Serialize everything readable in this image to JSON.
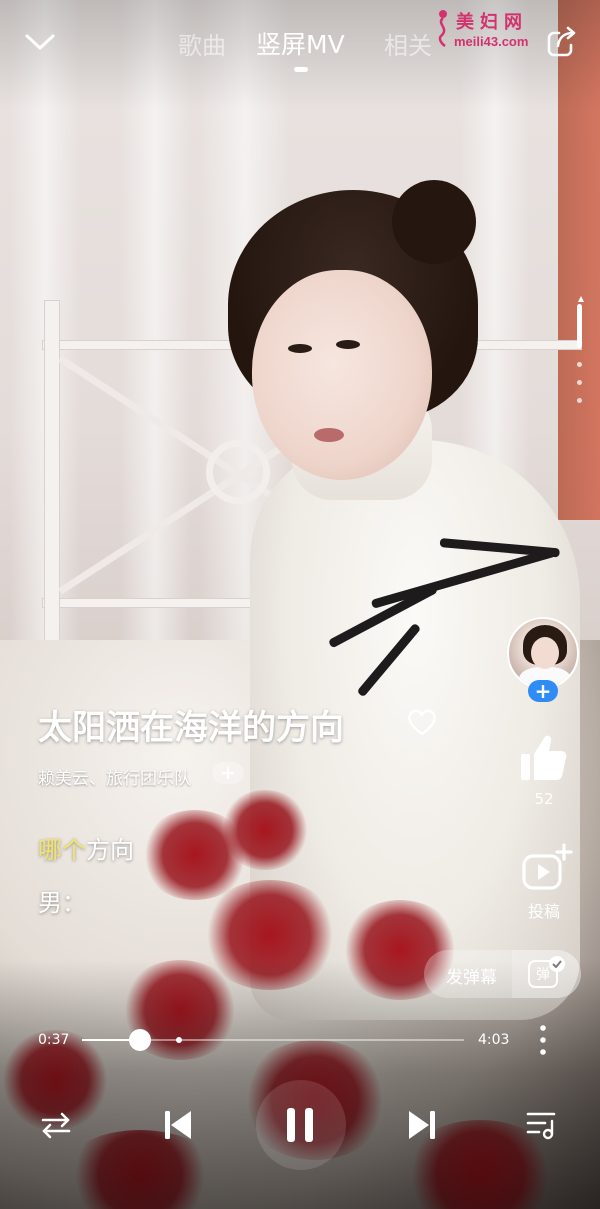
{
  "header": {
    "tabs": [
      {
        "label": "歌曲",
        "active": false
      },
      {
        "label": "竖屏MV",
        "active": true
      },
      {
        "label": "相关",
        "active": false
      }
    ],
    "watermark": {
      "title": "美妇网",
      "url": "meili43.com"
    }
  },
  "song": {
    "title": "太阳洒在海洋的方向",
    "artists": "赖美云、旅行团乐队",
    "follow_artist_label": "+"
  },
  "lyrics": {
    "current_highlight": "哪个",
    "current_rest": "方向",
    "next": "男："
  },
  "actions": {
    "follow_label": "+",
    "like_count": "52",
    "submit_label": "投稿"
  },
  "danmaku": {
    "send_label": "发弹幕",
    "toggle_label": "弹"
  },
  "player": {
    "current_time": "0:37",
    "total_time": "4:03",
    "progress_fraction": 0.152,
    "buffered_fraction": 0.253
  },
  "icons": {
    "back": "chevron-down-icon",
    "share": "share-icon",
    "heart": "heart-icon",
    "like": "thumbs-up-icon",
    "submit": "video-plus-icon",
    "more": "more-vertical-icon",
    "mode": "loop-icon",
    "prev": "previous-icon",
    "play": "pause-icon",
    "next": "next-icon",
    "playlist": "playlist-icon"
  },
  "colors": {
    "lyric_highlight": "#f2e46b",
    "follow_blue": "#2f8cf5",
    "watermark": "#d2336f"
  }
}
